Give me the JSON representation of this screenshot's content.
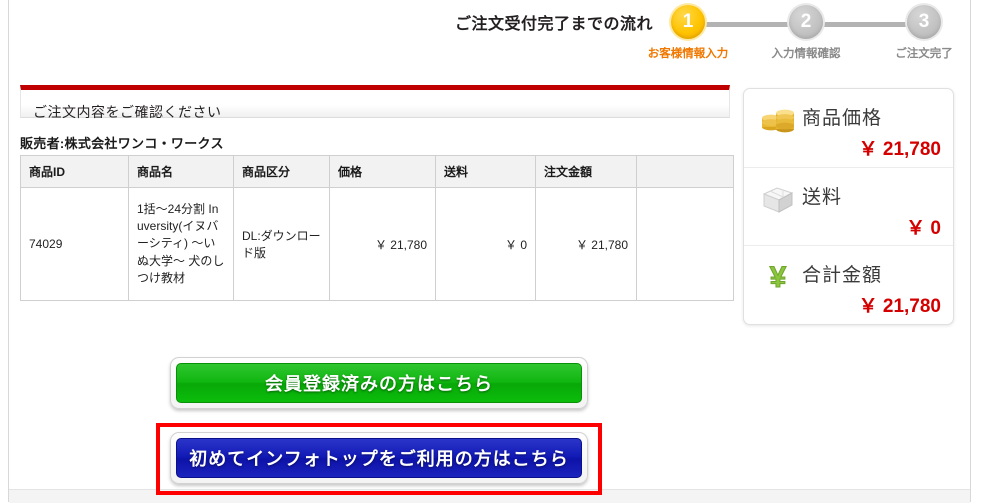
{
  "flow": {
    "title": "ご注文受付完了までの流れ",
    "steps": [
      {
        "number": "1",
        "label": "お客様情報入力",
        "state": "active"
      },
      {
        "number": "2",
        "label": "入力情報確認",
        "state": "inactive"
      },
      {
        "number": "3",
        "label": "ご注文完了",
        "state": "inactive"
      }
    ]
  },
  "section": {
    "heading": "ご注文内容をご確認ください",
    "accent_color": "#c00000"
  },
  "seller": {
    "text": "販売者:株式会社ワンコ・ワークス"
  },
  "order_table": {
    "headers": [
      "商品ID",
      "商品名",
      "商品区分",
      "価格",
      "送料",
      "注文金額",
      ""
    ],
    "rows": [
      {
        "product_id": "74029",
        "product_name": "1括〜24分割 Inuversity(イヌバーシティ) 〜いぬ大学〜 犬のしつけ教材",
        "product_type": "DL:ダウンロード版",
        "price": "￥ 21,780",
        "shipping": "￥ 0",
        "order_amount": "￥ 21,780",
        "extra": ""
      }
    ]
  },
  "summary": {
    "rows": [
      {
        "icon": "coins-icon",
        "label": "商品価格",
        "value": "￥ 21,780"
      },
      {
        "icon": "box-icon",
        "label": "送料",
        "value": "￥ 0"
      },
      {
        "icon": "yen-icon",
        "label": "合計金額",
        "value": "￥ 21,780"
      }
    ],
    "value_color": "#d40000"
  },
  "buttons": {
    "member": {
      "label": "会員登録済みの方はこちら",
      "color": "#0bb70b"
    },
    "first_time": {
      "label": "初めてインフォトップをご利用の方はこちら",
      "color": "#1119b5"
    }
  },
  "highlight": {
    "color": "#ff0000"
  }
}
